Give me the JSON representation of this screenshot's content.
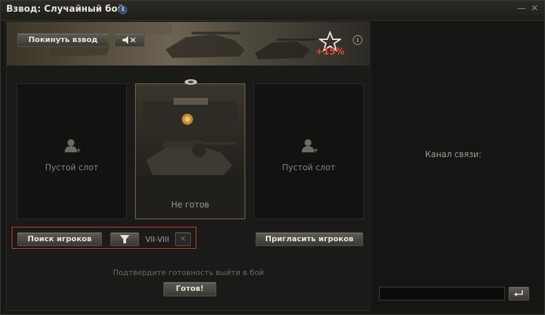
{
  "window": {
    "title": "Взвод: Случайный бой"
  },
  "banner": {
    "leave_label": "Покинуть взвод",
    "mute_icon": "speaker-mute",
    "bonus": "+15%"
  },
  "slots": [
    {
      "label": "Пустой слот"
    },
    {
      "label": "Не готов"
    },
    {
      "label": "Пустой слот"
    }
  ],
  "search": {
    "label": "Поиск игроков",
    "tier": "VII-VIII"
  },
  "invite_label": "Пригласить игроков",
  "confirm_text": "Подтвердите готовность выйти в бой",
  "ready_label": "Готов!",
  "chat": {
    "channel_label": "Канал связи:"
  },
  "colors": {
    "highlight": "#d43c2f",
    "bonus": "#e8493a",
    "accent_gold": "#d9a441"
  }
}
